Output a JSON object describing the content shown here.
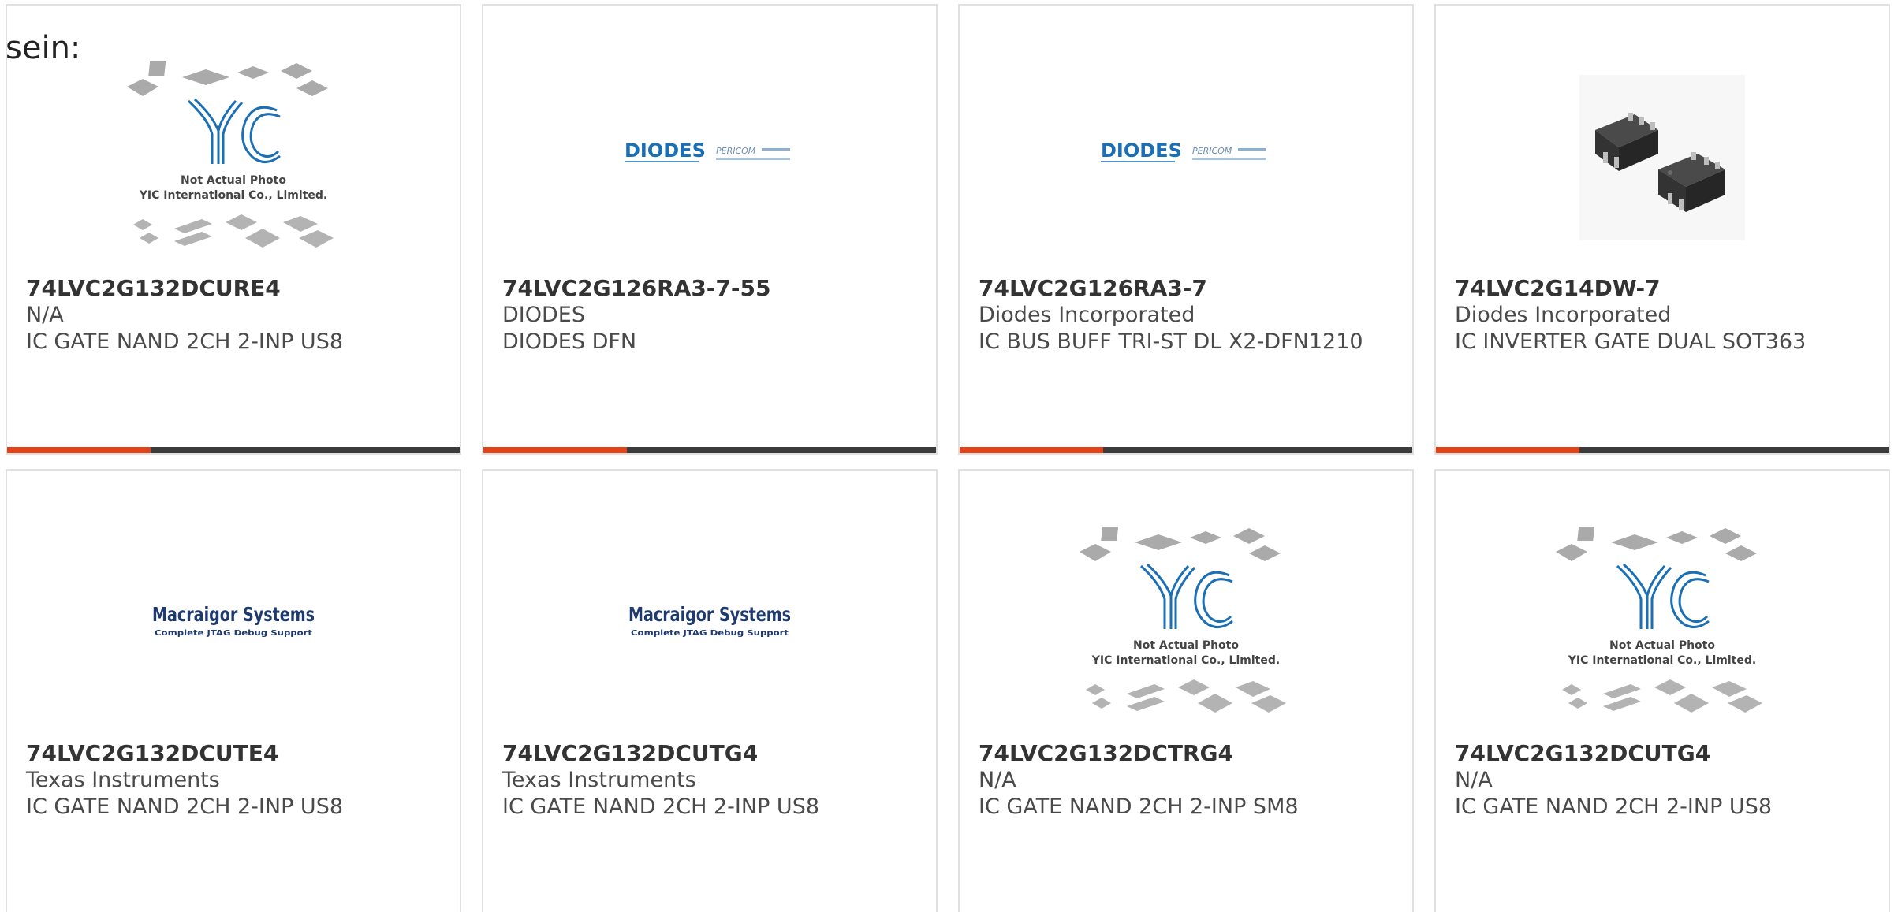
{
  "lead_text": "sein:",
  "colors": {
    "accent": "#e2421a",
    "bar": "#3b3b3b",
    "border": "#e1e1e1",
    "diodes_blue": "#1b6fb5",
    "macraigor_navy": "#1e3a6e"
  },
  "products": [
    {
      "part_number": "74LVC2G132DCURE4",
      "manufacturer": "N/A",
      "description": "IC GATE NAND 2CH 2-INP US8",
      "image": "yic-placeholder",
      "image_text": [
        "Not Actual Photo",
        "YIC International Co., Limited."
      ]
    },
    {
      "part_number": "74LVC2G126RA3-7-55",
      "manufacturer": "DIODES",
      "description": "DIODES DFN",
      "image": "diodes-pericom-logo",
      "image_text": [
        "DIODES",
        "PERICOM"
      ]
    },
    {
      "part_number": "74LVC2G126RA3-7",
      "manufacturer": "Diodes Incorporated",
      "description": "IC BUS BUFF TRI-ST DL X2-DFN1210",
      "image": "diodes-pericom-logo",
      "image_text": [
        "DIODES",
        "PERICOM"
      ]
    },
    {
      "part_number": "74LVC2G14DW-7",
      "manufacturer": "Diodes Incorporated",
      "description": "IC INVERTER GATE DUAL SOT363",
      "image": "sot363-chip-photo",
      "image_text": []
    },
    {
      "part_number": "74LVC2G132DCUTE4",
      "manufacturer": "Texas Instruments",
      "description": "IC GATE NAND 2CH 2-INP US8",
      "image": "macraigor-logo",
      "image_text": [
        "Macraigor Systems",
        "Complete JTAG Debug Support"
      ]
    },
    {
      "part_number": "74LVC2G132DCUTG4",
      "manufacturer": "Texas Instruments",
      "description": "IC GATE NAND 2CH 2-INP US8",
      "image": "macraigor-logo",
      "image_text": [
        "Macraigor Systems",
        "Complete JTAG Debug Support"
      ]
    },
    {
      "part_number": "74LVC2G132DCTRG4",
      "manufacturer": "N/A",
      "description": "IC GATE NAND 2CH 2-INP SM8",
      "image": "yic-placeholder",
      "image_text": [
        "Not Actual Photo",
        "YIC International Co., Limited."
      ]
    },
    {
      "part_number": "74LVC2G132DCUTG4",
      "manufacturer": "N/A",
      "description": "IC GATE NAND 2CH 2-INP US8",
      "image": "yic-placeholder",
      "image_text": [
        "Not Actual Photo",
        "YIC International Co., Limited."
      ]
    }
  ]
}
